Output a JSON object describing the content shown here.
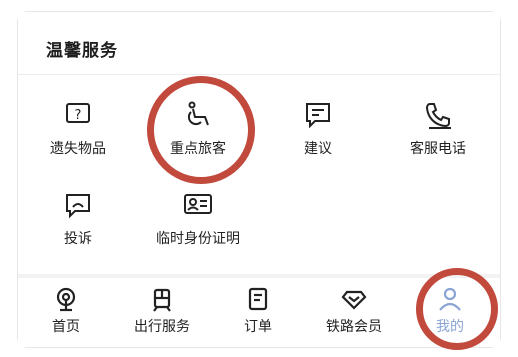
{
  "section": {
    "title": "温馨服务"
  },
  "services": [
    {
      "label": "遗失物品",
      "icon": "lost-items-icon"
    },
    {
      "label": "重点旅客",
      "icon": "wheelchair-icon"
    },
    {
      "label": "建议",
      "icon": "suggestion-icon"
    },
    {
      "label": "客服电话",
      "icon": "phone-icon"
    },
    {
      "label": "投诉",
      "icon": "complaint-icon"
    },
    {
      "label": "临时身份证明",
      "icon": "id-card-icon"
    }
  ],
  "tabs": [
    {
      "label": "首页",
      "icon": "home-icon"
    },
    {
      "label": "出行服务",
      "icon": "train-icon"
    },
    {
      "label": "订单",
      "icon": "order-icon"
    },
    {
      "label": "铁路会员",
      "icon": "member-icon"
    },
    {
      "label": "我的",
      "icon": "user-icon",
      "active": true
    }
  ],
  "colors": {
    "annotation": "#c24a3d",
    "active_tab": "#8aa4d4",
    "icon": "#222222"
  }
}
